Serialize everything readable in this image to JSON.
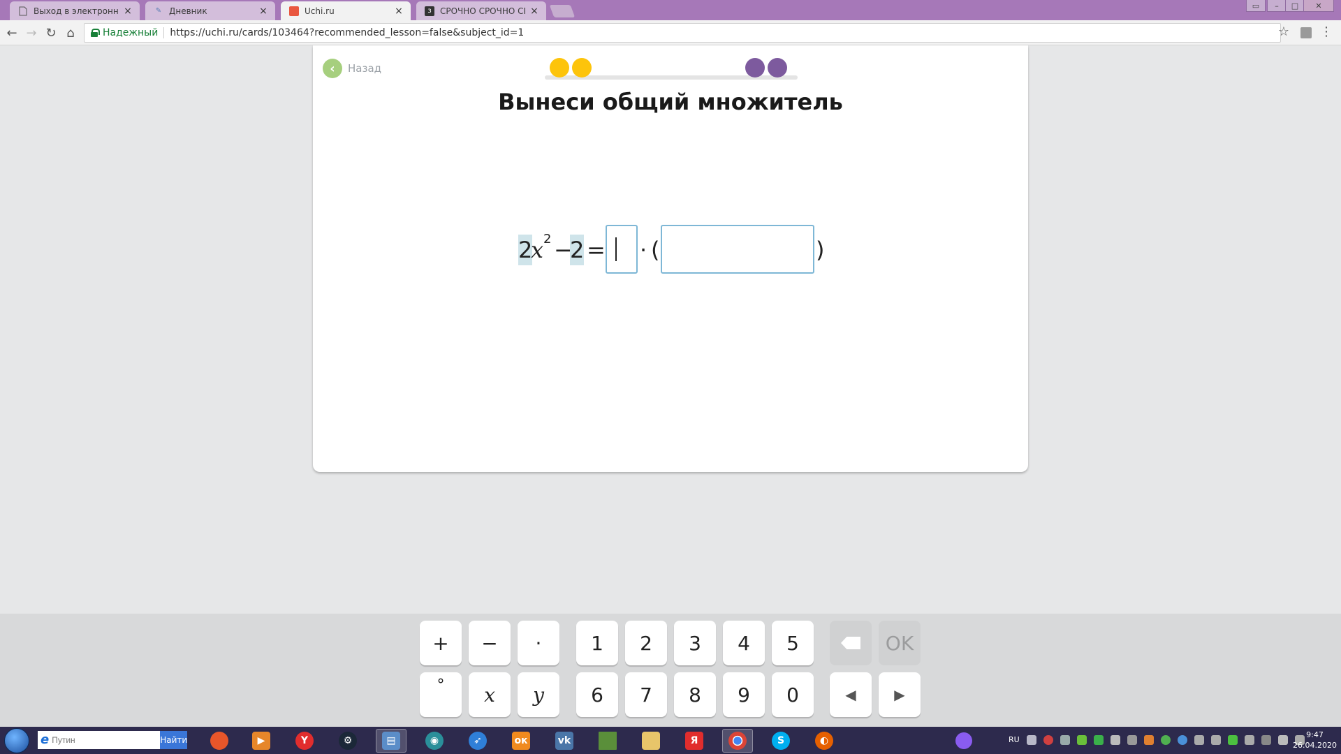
{
  "browser": {
    "tabs": [
      {
        "label": "Выход в электронный ж",
        "active": false,
        "favicon": "page-icon"
      },
      {
        "label": "Дневник",
        "active": false,
        "favicon": "diary-icon"
      },
      {
        "label": "Uchi.ru",
        "active": true,
        "favicon": "uchi-icon"
      },
      {
        "label": "СРОЧНО СРОЧНО СРОЧ",
        "active": false,
        "favicon": "znanija-icon"
      }
    ],
    "close_glyph": "×",
    "secure_label": "Надежный",
    "url": "https://uchi.ru/cards/103464?recommended_lesson=false&subject_id=1"
  },
  "card": {
    "back_label": "Назад",
    "title": "Вынеси общий множитель",
    "equation": {
      "coef": "2",
      "var": "x",
      "exp": "2",
      "minus": "−",
      "const": "2",
      "equals": "=",
      "dot": "·",
      "open_paren": "(",
      "close_paren": ")",
      "answer1": "",
      "answer2": ""
    },
    "progress_colors": {
      "done": "#fdc40b",
      "pending": "#7d5a9e"
    }
  },
  "keyboard": {
    "row1": [
      "+",
      "−",
      "·",
      "1",
      "2",
      "3",
      "4",
      "5"
    ],
    "row2": [
      "°",
      "x",
      "y",
      "6",
      "7",
      "8",
      "9",
      "0"
    ],
    "ok_label": "OK",
    "left_arrow": "◀",
    "right_arrow": "▶"
  },
  "taskbar": {
    "search_placeholder": "Путин",
    "search_button": "Найти",
    "lang": "RU",
    "time": "9:47",
    "date": "26.04.2020",
    "colors": {
      "accent": "#3a76d8"
    }
  }
}
